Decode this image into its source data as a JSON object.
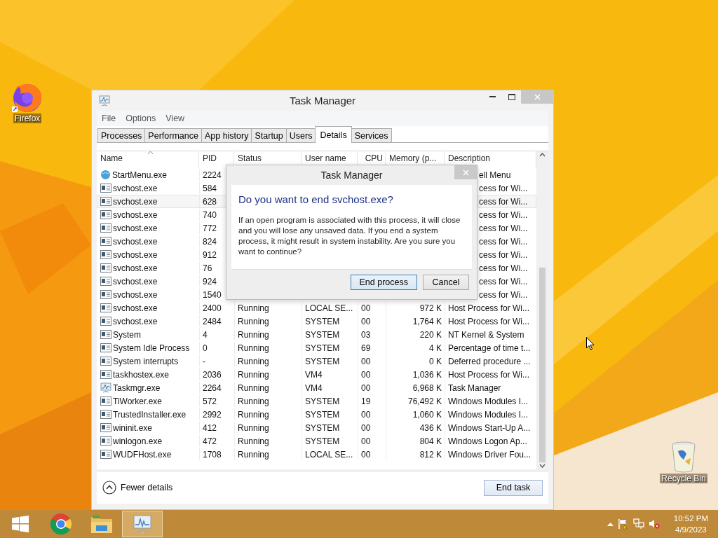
{
  "desktop_icons": [
    {
      "label": "Firefox",
      "kind": "firefox"
    },
    {
      "label": "Recycle Bin",
      "kind": "recycle"
    }
  ],
  "window": {
    "title": "Task Manager",
    "menu": [
      "File",
      "Options",
      "View"
    ],
    "tabs": [
      {
        "label": "Processes",
        "selected": false
      },
      {
        "label": "Performance",
        "selected": false
      },
      {
        "label": "App history",
        "selected": false
      },
      {
        "label": "Startup",
        "selected": false
      },
      {
        "label": "Users",
        "selected": false
      },
      {
        "label": "Details",
        "selected": true
      },
      {
        "label": "Services",
        "selected": false
      }
    ],
    "table": {
      "columns": [
        {
          "label": "Name",
          "sorted": true
        },
        {
          "label": "PID",
          "sorted": false
        },
        {
          "label": "Status",
          "sorted": false
        },
        {
          "label": "User name",
          "sorted": false
        },
        {
          "label": "CPU",
          "sorted": false
        },
        {
          "label": "Memory (p...",
          "sorted": false
        },
        {
          "label": "Description",
          "sorted": false
        }
      ],
      "rows": [
        {
          "kind": "globe",
          "name": "StartMenu.exe",
          "pid": "2224",
          "description": "ell Menu",
          "selected": false
        },
        {
          "kind": "window",
          "name": "svchost.exe",
          "pid": "584",
          "description": "cess for Wi...",
          "selected": false
        },
        {
          "kind": "window",
          "name": "svchost.exe",
          "pid": "628",
          "description": "cess for Wi...",
          "selected": true
        },
        {
          "kind": "window",
          "name": "svchost.exe",
          "pid": "740",
          "description": "cess for Wi...",
          "selected": false
        },
        {
          "kind": "window",
          "name": "svchost.exe",
          "pid": "772",
          "description": "cess for Wi...",
          "selected": false
        },
        {
          "kind": "window",
          "name": "svchost.exe",
          "pid": "824",
          "description": "cess for Wi...",
          "selected": false
        },
        {
          "kind": "window",
          "name": "svchost.exe",
          "pid": "912",
          "description": "cess for Wi...",
          "selected": false
        },
        {
          "kind": "window",
          "name": "svchost.exe",
          "pid": "76",
          "description": "cess for Wi...",
          "selected": false
        },
        {
          "kind": "window",
          "name": "svchost.exe",
          "pid": "924",
          "description": "cess for Wi...",
          "selected": false
        },
        {
          "kind": "window",
          "name": "svchost.exe",
          "pid": "1540",
          "description": "cess for Wi...",
          "selected": false
        },
        {
          "kind": "window",
          "name": "svchost.exe",
          "pid": "2400",
          "status": "Running",
          "user": "LOCAL SE...",
          "cpu": "00",
          "memory": "972 K",
          "description": "Host Process for Wi...",
          "selected": false
        },
        {
          "kind": "window",
          "name": "svchost.exe",
          "pid": "2484",
          "status": "Running",
          "user": "SYSTEM",
          "cpu": "00",
          "memory": "1,764 K",
          "description": "Host Process for Wi...",
          "selected": false
        },
        {
          "kind": "window",
          "name": "System",
          "pid": "4",
          "status": "Running",
          "user": "SYSTEM",
          "cpu": "03",
          "memory": "220 K",
          "description": "NT Kernel & System",
          "selected": false
        },
        {
          "kind": "window",
          "name": "System Idle Process",
          "pid": "0",
          "status": "Running",
          "user": "SYSTEM",
          "cpu": "69",
          "memory": "4 K",
          "description": "Percentage of time t...",
          "selected": false
        },
        {
          "kind": "window",
          "name": "System interrupts",
          "pid": "-",
          "status": "Running",
          "user": "SYSTEM",
          "cpu": "00",
          "memory": "0 K",
          "description": "Deferred procedure ...",
          "selected": false
        },
        {
          "kind": "window",
          "name": "taskhostex.exe",
          "pid": "2036",
          "status": "Running",
          "user": "VM4",
          "cpu": "00",
          "memory": "1,036 K",
          "description": "Host Process for Wi...",
          "selected": false
        },
        {
          "kind": "chart",
          "name": "Taskmgr.exe",
          "pid": "2264",
          "status": "Running",
          "user": "VM4",
          "cpu": "00",
          "memory": "6,968 K",
          "description": "Task Manager",
          "selected": false
        },
        {
          "kind": "window",
          "name": "TiWorker.exe",
          "pid": "572",
          "status": "Running",
          "user": "SYSTEM",
          "cpu": "19",
          "memory": "76,492 K",
          "description": "Windows Modules I...",
          "selected": false
        },
        {
          "kind": "window",
          "name": "TrustedInstaller.exe",
          "pid": "2992",
          "status": "Running",
          "user": "SYSTEM",
          "cpu": "00",
          "memory": "1,060 K",
          "description": "Windows Modules I...",
          "selected": false
        },
        {
          "kind": "window",
          "name": "wininit.exe",
          "pid": "412",
          "status": "Running",
          "user": "SYSTEM",
          "cpu": "00",
          "memory": "436 K",
          "description": "Windows Start-Up A...",
          "selected": false
        },
        {
          "kind": "window",
          "name": "winlogon.exe",
          "pid": "472",
          "status": "Running",
          "user": "SYSTEM",
          "cpu": "00",
          "memory": "804 K",
          "description": "Windows Logon Ap...",
          "selected": false
        },
        {
          "kind": "window",
          "name": "WUDFHost.exe",
          "pid": "1708",
          "status": "Running",
          "user": "LOCAL SE...",
          "cpu": "00",
          "memory": "812 K",
          "description": "Windows Driver Fou...",
          "selected": false
        }
      ]
    },
    "footer": {
      "toggle": "Fewer details",
      "button": "End task"
    }
  },
  "dialog": {
    "title": "Task Manager",
    "heading": "Do you want to end svchost.exe?",
    "message": "If an open program is associated with this process, it will close and you will lose any unsaved data. If you end a system process, it might result in system instability. Are you sure you want to continue?",
    "buttons": [
      {
        "label": "End process",
        "default": true
      },
      {
        "label": "Cancel",
        "default": false
      }
    ]
  },
  "taskbar": {
    "apps": [
      {
        "kind": "start",
        "active": false
      },
      {
        "kind": "chrome",
        "active": false
      },
      {
        "kind": "explorer",
        "active": false
      },
      {
        "kind": "taskmgr",
        "active": true
      }
    ],
    "clock": {
      "time": "10:52 PM",
      "date": "4/9/2023"
    }
  }
}
